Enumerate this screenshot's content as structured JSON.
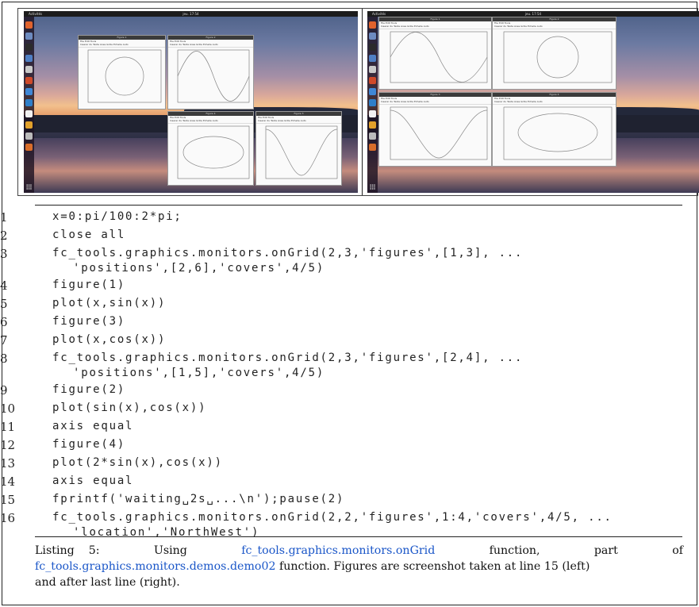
{
  "screenshots": {
    "left": {
      "topbar_left": "Activités",
      "topbar_app": "MATLAB",
      "topbar_center": "jeu. 17:54",
      "figures": [
        {
          "title": "Figure 1",
          "curve": "circle",
          "menu": "File  Edit  Tools",
          "toolbar": "Inserer du Texte  Axes  Grille  Echelle Auto"
        },
        {
          "title": "Figure 2",
          "curve": "sine",
          "menu": "File  Edit  Tools",
          "toolbar": "Inserer du Texte  Axes  Grille  Echelle Auto"
        },
        {
          "title": "Figure 4",
          "curve": "ellipse",
          "menu": "File  Edit  Tools",
          "toolbar": "Inserer du Texte  Axes  Grille  Echelle Auto"
        },
        {
          "title": "Figure 3",
          "curve": "cosine",
          "menu": "File  Edit  Tools",
          "toolbar": "Inserer du Texte  Axes  Grille  Echelle Auto"
        }
      ]
    },
    "right": {
      "topbar_left": "Activités",
      "topbar_app": "MATLAB",
      "topbar_center": "jeu. 17:54",
      "figures": [
        {
          "title": "Figure 1",
          "curve": "sine",
          "menu": "File  Edit  Tools",
          "toolbar": "Inserer du Texte  Axes  Grille  Echelle Auto"
        },
        {
          "title": "Figure 2",
          "curve": "circle",
          "menu": "File  Edit  Tools",
          "toolbar": "Inserer du Texte  Axes  Grille  Echelle Auto"
        },
        {
          "title": "Figure 3",
          "curve": "cosine",
          "menu": "File  Edit  Tools",
          "toolbar": "Inserer du Texte  Axes  Grille  Echelle Auto"
        },
        {
          "title": "Figure 4",
          "curve": "ellipse",
          "menu": "File  Edit  Tools",
          "toolbar": "Inserer du Texte  Axes  Grille  Echelle Auto"
        }
      ]
    }
  },
  "listing": {
    "lines": [
      {
        "num": "1",
        "code": "x=0:pi/100:2*pi;"
      },
      {
        "num": "2",
        "code": "close all"
      },
      {
        "num": "3",
        "code": "fc_tools.graphics.monitors.onGrid(2,3,'figures',[1,3], ...",
        "cont": "'positions',[2,6],'covers',4/5)"
      },
      {
        "num": "4",
        "code": "figure(1)"
      },
      {
        "num": "5",
        "code": "plot(x,sin(x))"
      },
      {
        "num": "6",
        "code": "figure(3)"
      },
      {
        "num": "7",
        "code": "plot(x,cos(x))"
      },
      {
        "num": "8",
        "code": "fc_tools.graphics.monitors.onGrid(2,3,'figures',[2,4], ...",
        "cont": "'positions',[1,5],'covers',4/5)"
      },
      {
        "num": "9",
        "code": "figure(2)"
      },
      {
        "num": "10",
        "code": "plot(sin(x),cos(x))"
      },
      {
        "num": "11",
        "code": "axis equal"
      },
      {
        "num": "12",
        "code": "figure(4)"
      },
      {
        "num": "13",
        "code": "plot(2*sin(x),cos(x))"
      },
      {
        "num": "14",
        "code": "axis equal"
      },
      {
        "num": "15",
        "code": "fprintf('waiting␣2s␣...\\n');pause(2)"
      },
      {
        "num": "16",
        "code": "fc_tools.graphics.monitors.onGrid(2,2,'figures',1:4,'covers',4/5, ...",
        "cont": "'location','NorthWest')"
      }
    ]
  },
  "caption": {
    "label": "Listing",
    "number": "5:",
    "using": "Using",
    "fn1": "fc_tools.graphics.monitors.onGrid",
    "function_word": "function,",
    "part": "part",
    "of": "of",
    "fn2": "fc_tools.graphics.monitors.demos.demo02",
    "rest2": " function. Figures are screenshot taken at line 15 (left)",
    "line3": "and after last line (right)."
  }
}
